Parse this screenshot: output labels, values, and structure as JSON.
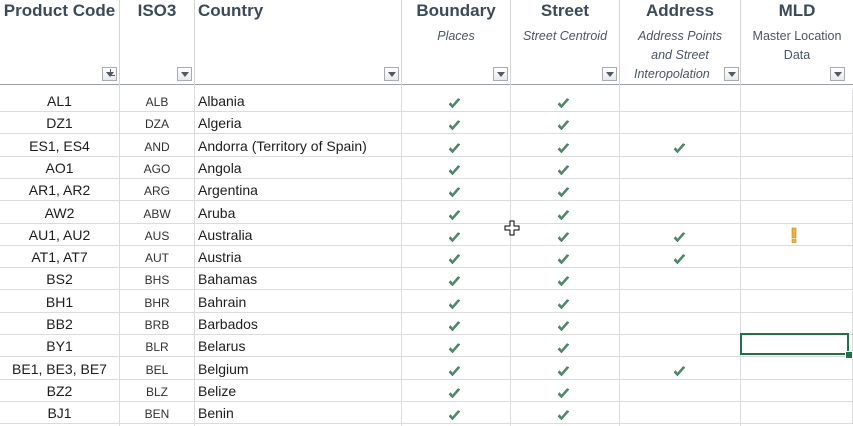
{
  "headers": {
    "product_code": {
      "title": "Product Code"
    },
    "iso3": {
      "title": "ISO3"
    },
    "country": {
      "title": "Country"
    },
    "boundary": {
      "title": "Boundary",
      "sub": "Places"
    },
    "street": {
      "title": "Street",
      "sub": "Street Centroid"
    },
    "address": {
      "title": "Address",
      "sub_lines": [
        "Address Points",
        "and Street",
        "Interopolation"
      ]
    },
    "mld": {
      "title": "MLD",
      "sub_lines": [
        "Master Location",
        "Data"
      ]
    }
  },
  "colors": {
    "check": "#4f8a6a",
    "warning": "#e8b33a",
    "selection": "#217346",
    "header_text": "#3b4a5a"
  },
  "icons": {
    "check": "check-icon",
    "warning": "exclamation-icon",
    "filter": "filter-dropdown-icon",
    "filter_active": "filter-active-icon",
    "cursor": "crosshair-cursor-icon"
  },
  "rows": [
    {
      "code": "AL1",
      "iso": "ALB",
      "country": "Albania",
      "boundary": true,
      "street": true,
      "address": false,
      "mld": false
    },
    {
      "code": "DZ1",
      "iso": "DZA",
      "country": "Algeria",
      "boundary": true,
      "street": true,
      "address": false,
      "mld": false
    },
    {
      "code": "ES1, ES4",
      "iso": "AND",
      "country": "Andorra (Territory of Spain)",
      "boundary": true,
      "street": true,
      "address": true,
      "mld": false
    },
    {
      "code": "AO1",
      "iso": "AGO",
      "country": "Angola",
      "boundary": true,
      "street": true,
      "address": false,
      "mld": false
    },
    {
      "code": "AR1, AR2",
      "iso": "ARG",
      "country": "Argentina",
      "boundary": true,
      "street": true,
      "address": false,
      "mld": false
    },
    {
      "code": "AW2",
      "iso": "ABW",
      "country": "Aruba",
      "boundary": true,
      "street": true,
      "address": false,
      "mld": false
    },
    {
      "code": "AU1, AU2",
      "iso": "AUS",
      "country": "Australia",
      "boundary": true,
      "street": true,
      "address": true,
      "mld": "warning"
    },
    {
      "code": "AT1, AT7",
      "iso": "AUT",
      "country": "Austria",
      "boundary": true,
      "street": true,
      "address": true,
      "mld": false
    },
    {
      "code": "BS2",
      "iso": "BHS",
      "country": "Bahamas",
      "boundary": true,
      "street": true,
      "address": false,
      "mld": false
    },
    {
      "code": "BH1",
      "iso": "BHR",
      "country": "Bahrain",
      "boundary": true,
      "street": true,
      "address": false,
      "mld": false
    },
    {
      "code": "BB2",
      "iso": "BRB",
      "country": "Barbados",
      "boundary": true,
      "street": true,
      "address": false,
      "mld": false
    },
    {
      "code": "BY1",
      "iso": "BLR",
      "country": "Belarus",
      "boundary": true,
      "street": true,
      "address": false,
      "mld": false
    },
    {
      "code": "BE1, BE3, BE7",
      "iso": "BEL",
      "country": "Belgium",
      "boundary": true,
      "street": true,
      "address": true,
      "mld": false
    },
    {
      "code": "BZ2",
      "iso": "BLZ",
      "country": "Belize",
      "boundary": true,
      "street": true,
      "address": false,
      "mld": false
    },
    {
      "code": "BJ1",
      "iso": "BEN",
      "country": "Benin",
      "boundary": true,
      "street": true,
      "address": false,
      "mld": false
    }
  ]
}
